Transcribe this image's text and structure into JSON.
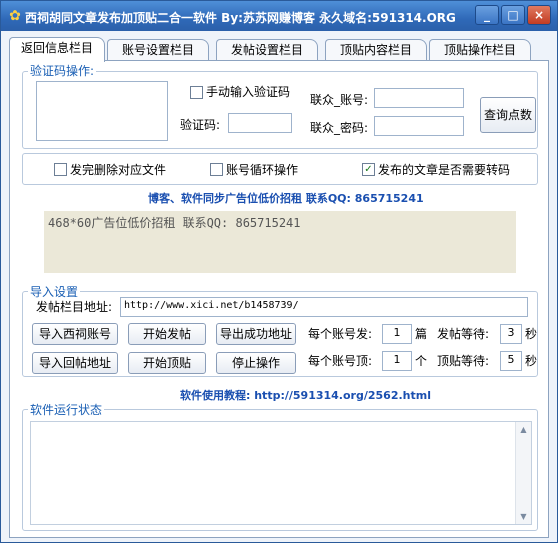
{
  "window": {
    "title": "西祠胡同文章发布加顶贴二合一软件  By:苏苏网赚博客  永久域名:591314.ORG",
    "min_symbol": "_",
    "max_symbol": "□",
    "close_symbol": "×"
  },
  "tabs": [
    {
      "label": "返回信息栏目"
    },
    {
      "label": "账号设置栏目"
    },
    {
      "label": "发帖设置栏目"
    },
    {
      "label": "顶贴内容栏目"
    },
    {
      "label": "顶贴操作栏目"
    }
  ],
  "captcha": {
    "group_title": "验证码操作:",
    "manual_label": "手动输入验证码",
    "manual_checked": false,
    "code_label": "验证码:",
    "code_value": "",
    "account_label": "联众_账号:",
    "account_value": "",
    "password_label": "联众_密码:",
    "password_value": "",
    "query_button": "查询点数"
  },
  "options": {
    "delete_file_label": "发完删除对应文件",
    "delete_file_checked": false,
    "loop_accounts_label": "账号循环操作",
    "loop_accounts_checked": false,
    "transcode_label": "发布的文章是否需要转码",
    "transcode_checked": true
  },
  "ad": {
    "banner_text": "博客、软件同步广告位低价招租  联系QQ: 865715241",
    "box_text": "468*60广告位低价招租 联系QQ: 865715241"
  },
  "import": {
    "group_title": "导入设置",
    "url_label": "发帖栏目地址:",
    "url_value": "http://www.xici.net/b1458739/",
    "btn_import_accounts": "导入西祠账号",
    "btn_start_post": "开始发帖",
    "btn_export_success": "导出成功地址",
    "btn_import_reply": "导入回帖地址",
    "btn_start_top": "开始顶贴",
    "btn_stop": "停止操作",
    "per_account_post_label": "每个账号发:",
    "per_account_post_value": "1",
    "per_account_post_unit": "篇",
    "post_wait_label": "发帖等待:",
    "post_wait_value": "3",
    "post_wait_unit": "秒",
    "per_account_top_label": "每个账号顶:",
    "per_account_top_value": "1",
    "per_account_top_unit": "个",
    "top_wait_label": "顶贴等待:",
    "top_wait_value": "5",
    "top_wait_unit": "秒"
  },
  "tutorial": {
    "text": "软件使用教程: http://591314.org/2562.html"
  },
  "status": {
    "group_title": "软件运行状态",
    "scroll_up": "▲",
    "scroll_down": "▼"
  },
  "check_symbol": "✓"
}
